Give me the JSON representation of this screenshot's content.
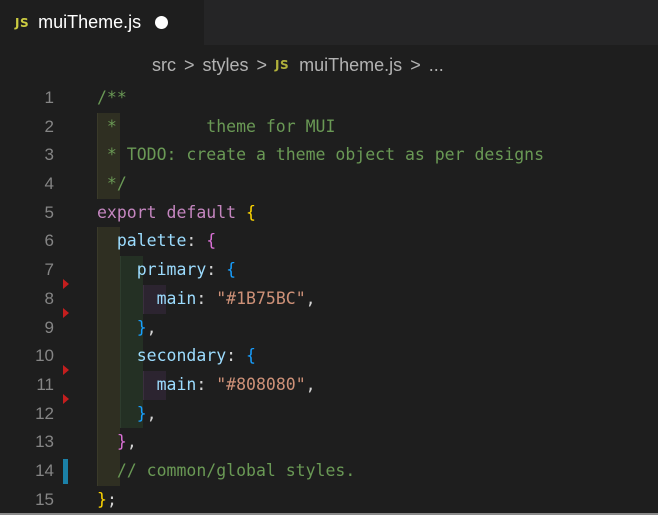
{
  "tab": {
    "icon": "JS",
    "label": "muiTheme.js",
    "unsaved": true
  },
  "breadcrumb": {
    "items": [
      "src",
      "styles",
      "muiTheme.js",
      "..."
    ],
    "separator": ">",
    "file_icon": "JS"
  },
  "editor": {
    "lines": [
      {
        "n": "1",
        "tokens": [
          [
            "/**",
            "com"
          ]
        ]
      },
      {
        "n": "2",
        "tokens": [
          [
            " *         theme for MUI",
            "com"
          ]
        ]
      },
      {
        "n": "3",
        "tokens": [
          [
            " * TODO: create a theme object as per designs",
            "com"
          ]
        ]
      },
      {
        "n": "4",
        "tokens": [
          [
            " */",
            "com"
          ]
        ]
      },
      {
        "n": "5",
        "tokens": [
          [
            "export default ",
            "kw"
          ],
          [
            "{",
            "br1"
          ]
        ]
      },
      {
        "n": "6",
        "tokens": [
          [
            "  palette",
            "prop"
          ],
          [
            ": ",
            "punc"
          ],
          [
            "{",
            "br2"
          ]
        ]
      },
      {
        "n": "7",
        "tokens": [
          [
            "    primary",
            "prop"
          ],
          [
            ": ",
            "punc"
          ],
          [
            "{",
            "br3"
          ]
        ]
      },
      {
        "n": "8",
        "tokens": [
          [
            "      main",
            "prop"
          ],
          [
            ": ",
            "punc"
          ],
          [
            "\"#1B75BC\"",
            "str"
          ],
          [
            ",",
            "punc"
          ]
        ]
      },
      {
        "n": "9",
        "tokens": [
          [
            "    }",
            "br3"
          ],
          [
            ",",
            "punc"
          ]
        ]
      },
      {
        "n": "10",
        "tokens": [
          [
            "    secondary",
            "prop"
          ],
          [
            ": ",
            "punc"
          ],
          [
            "{",
            "br3"
          ]
        ]
      },
      {
        "n": "11",
        "tokens": [
          [
            "      main",
            "prop"
          ],
          [
            ": ",
            "punc"
          ],
          [
            "\"#808080\"",
            "str"
          ],
          [
            ",",
            "punc"
          ]
        ]
      },
      {
        "n": "12",
        "tokens": [
          [
            "    }",
            "br3"
          ],
          [
            ",",
            "punc"
          ]
        ]
      },
      {
        "n": "13",
        "tokens": [
          [
            "  }",
            "br2"
          ],
          [
            ",",
            "punc"
          ]
        ]
      },
      {
        "n": "14",
        "tokens": [
          [
            "  // common/global styles.",
            "com"
          ]
        ]
      },
      {
        "n": "15",
        "tokens": [
          [
            "}",
            "br1"
          ],
          [
            ";",
            "punc"
          ]
        ]
      }
    ],
    "deleted_markers_after_lines": [
      7,
      8,
      10,
      11
    ],
    "modified_lines": [
      14
    ]
  },
  "colors": {
    "background": "#1e1e1e",
    "tabbar": "#252526",
    "js_icon": "#cbcb41",
    "comment": "#6a9955",
    "keyword": "#c586c0",
    "property": "#9cdcfe",
    "string": "#ce9178",
    "deleted_marker": "#c41e1e",
    "modified_bar": "#1b81a8"
  }
}
